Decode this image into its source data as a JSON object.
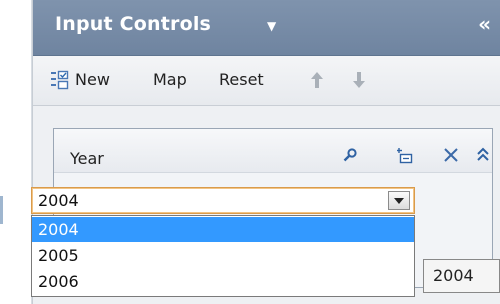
{
  "panel": {
    "title": "Input Controls",
    "title_caret": "▼",
    "collapse_glyph": "«"
  },
  "toolbar": {
    "new_label": "New",
    "map_label": "Map",
    "reset_label": "Reset",
    "icons": [
      "new-icon",
      "move-up-arrow-icon",
      "move-down-arrow-icon"
    ]
  },
  "control": {
    "label": "Year",
    "icons": [
      "search-icon",
      "edit-icon",
      "close-icon",
      "collapse-up-icon"
    ],
    "selected_value": "2004",
    "options": [
      {
        "label": "2004",
        "highlighted": true
      },
      {
        "label": "2005",
        "highlighted": false
      },
      {
        "label": "2006",
        "highlighted": false
      }
    ]
  },
  "tooltip": {
    "text": "2004"
  },
  "colors": {
    "header_bg": "#7489a5",
    "highlight": "#3399ff",
    "select_focus_border": "#d99b4c"
  }
}
